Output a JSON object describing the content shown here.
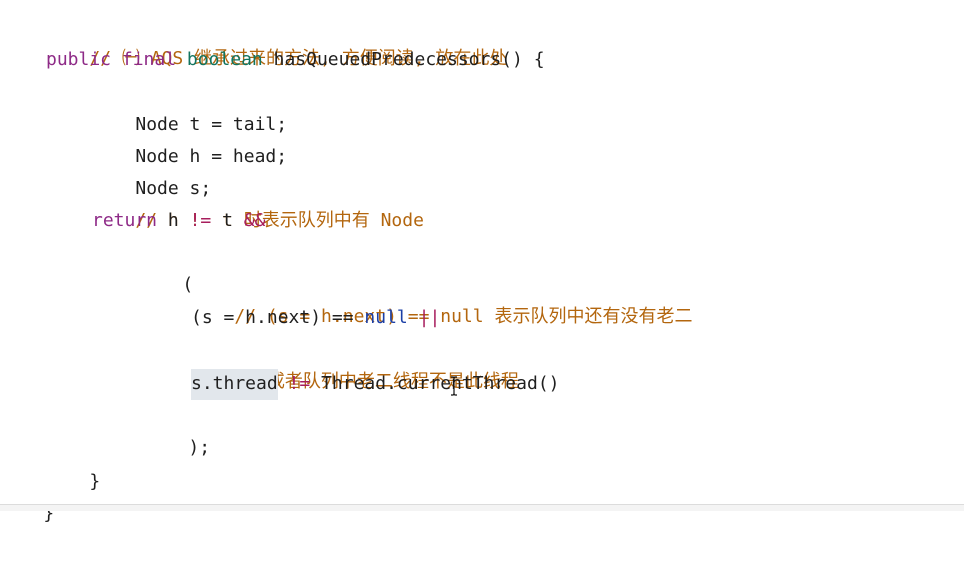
{
  "code": {
    "l01_comment": "// ㈠ AQS 继承过来的方法, 方便阅读, 放在此处",
    "l02_public": "public",
    "l02_final": "final",
    "l02_boolean": "boolean",
    "l02_sig": "hasQueuedPredecessors() {",
    "l03": "Node t = tail;",
    "l04": "Node h = head;",
    "l05": "Node s;",
    "l06_comment": "// h != t 时表示队列中有 Node",
    "l07_return": "return",
    "l07_a": "h",
    "l07_op1": "!=",
    "l07_b": "t",
    "l07_op2": "&&",
    "l08": "(",
    "l09_comment": "// (s = h.next) == null 表示队列中还有没有老二",
    "l10_a": "(s = h.next) ==",
    "l10_null": "null",
    "l10_op": "||",
    "l11_comment": "// 或者队列中老二线程不是此线程",
    "l12_hl": "s.thread",
    "l12_op": "!=",
    "l12_b": "Thread.currentThread()",
    "l13": ");",
    "l14": "}",
    "l15": "}"
  },
  "colors": {
    "comment": "#b3660e",
    "keyword": "#8e2a87",
    "type": "#127560",
    "operator": "#a71d5d",
    "null_literal": "#1b3fa6",
    "highlight_bg": "#e2e7ec"
  },
  "icons": {
    "text_cursor": "i-beam-cursor-icon"
  }
}
